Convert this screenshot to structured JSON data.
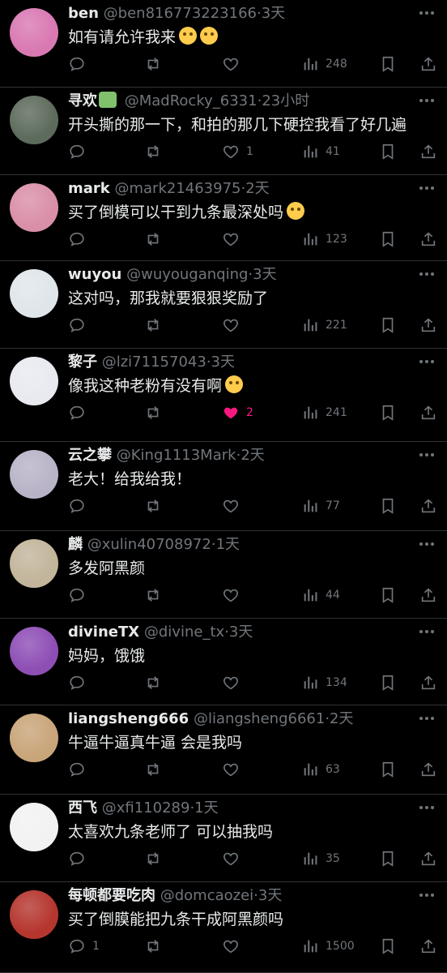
{
  "icons": {
    "reply": "reply-icon",
    "retweet": "retweet-icon",
    "like": "heart-icon",
    "views": "views-icon",
    "bookmark": "bookmark-icon",
    "share": "share-icon",
    "more": "more-icon"
  },
  "colors": {
    "background": "#000000",
    "text": "#e7e9ea",
    "muted": "#71767b",
    "divider": "#2f3336",
    "like_active": "#f91880"
  },
  "replies": [
    {
      "name": "ben",
      "handle": "@ben816773223166",
      "sep": "·",
      "time": "3天",
      "text": "如有请允许我来",
      "emoji_count": 2,
      "replies": "",
      "likes": "",
      "liked": false,
      "views": "248",
      "avatar_color": "#d979b3"
    },
    {
      "name": "寻欢",
      "handle": "@MadRocky_6331",
      "sep": "·",
      "time": "23小时",
      "text": "开头撕的那一下，和拍的那几下硬控我看了好几遍",
      "emoji_count": 0,
      "replies": "",
      "likes": "1",
      "liked": false,
      "views": "41",
      "avatar_color": "#5d6b5c"
    },
    {
      "name": "mark",
      "handle": "@mark21463975",
      "sep": "·",
      "time": "2天",
      "text": "买了倒模可以干到九条最深处吗",
      "emoji_count": 1,
      "replies": "",
      "likes": "",
      "liked": false,
      "views": "123",
      "avatar_color": "#d98fa8"
    },
    {
      "name": "wuyou",
      "handle": "@wuyouganqing",
      "sep": "·",
      "time": "3天",
      "text": "这对吗，那我就要狠狠奖励了",
      "emoji_count": 0,
      "replies": "",
      "likes": "",
      "liked": false,
      "views": "221",
      "avatar_color": "#dfe6ea"
    },
    {
      "name": "黎子",
      "handle": "@lzi71157043",
      "sep": "·",
      "time": "3天",
      "text": "像我这种老粉有没有啊",
      "emoji_count": 1,
      "replies": "",
      "likes": "2",
      "liked": true,
      "views": "241",
      "avatar_color": "#e8eaf0"
    },
    {
      "name": "云之攀",
      "handle": "@King1113Mark",
      "sep": "·",
      "time": "2天",
      "text": "老大！给我给我！",
      "emoji_count": 0,
      "replies": "",
      "likes": "",
      "liked": false,
      "views": "77",
      "avatar_color": "#b9b3c7"
    },
    {
      "name": "麟",
      "handle": "@xulin40708972",
      "sep": "·",
      "time": "1天",
      "text": "多发阿黑颜",
      "emoji_count": 0,
      "replies": "",
      "likes": "",
      "liked": false,
      "views": "44",
      "avatar_color": "#c2b59b"
    },
    {
      "name": "divineTX",
      "handle": "@divine_tx",
      "sep": "·",
      "time": "3天",
      "text": "妈妈，饿饿",
      "emoji_count": 0,
      "replies": "",
      "likes": "",
      "liked": false,
      "views": "134",
      "avatar_color": "#8e4fb5"
    },
    {
      "name": "liangsheng666",
      "handle": "@liangsheng6661",
      "sep": "·",
      "time": "2天",
      "text": "牛逼牛逼真牛逼 会是我吗",
      "emoji_count": 0,
      "replies": "",
      "likes": "",
      "liked": false,
      "views": "63",
      "avatar_color": "#c9a57a"
    },
    {
      "name": "西飞",
      "handle": "@xfi110289",
      "sep": "·",
      "time": "1天",
      "text": "太喜欢九条老师了 可以抽我吗",
      "emoji_count": 0,
      "replies": "",
      "likes": "",
      "liked": false,
      "views": "35",
      "avatar_color": "#f2f2f2"
    },
    {
      "name": "每顿都要吃肉",
      "handle": "@domcaozei",
      "sep": "·",
      "time": "3天",
      "text": "买了倒膜能把九条干成阿黑颜吗",
      "emoji_count": 0,
      "replies": "1",
      "likes": "",
      "liked": false,
      "views": "1500",
      "avatar_color": "#b5362f"
    }
  ]
}
